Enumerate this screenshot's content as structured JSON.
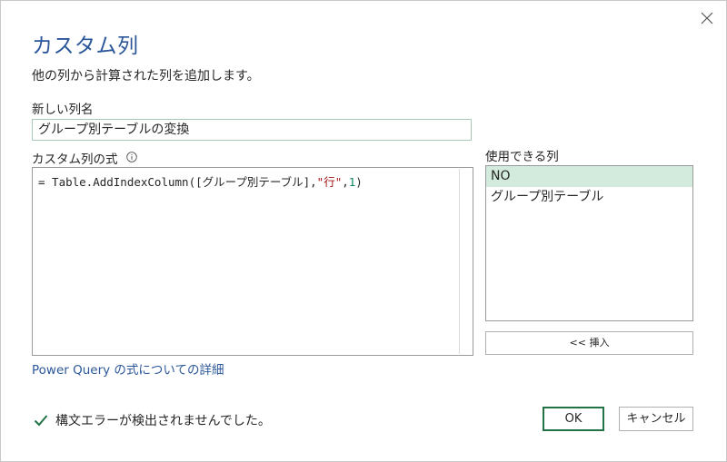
{
  "dialog": {
    "title": "カスタム列",
    "subtitle": "他の列から計算された列を追加します。",
    "close_icon": "close-icon"
  },
  "new_column": {
    "label": "新しい列名",
    "value": "グループ別テーブルの変換"
  },
  "formula": {
    "label": "カスタム列の式",
    "info_icon": "info-icon",
    "prefix": "= Table.AddIndexColumn([グループ別テーブル],",
    "string_arg": "\"行\"",
    "comma": ",",
    "number_arg": "1",
    "suffix": ")"
  },
  "available_columns": {
    "label": "使用できる列",
    "items": [
      "NO",
      "グループ別テーブル"
    ],
    "selected_index": 0,
    "insert_label": "<< 挿入"
  },
  "help_link": "Power Query の式についての詳細",
  "status": {
    "icon": "checkmark-icon",
    "text": "構文エラーが検出されませんでした。",
    "color": "#217346"
  },
  "buttons": {
    "ok": "OK",
    "cancel": "キャンセル"
  },
  "colors": {
    "title": "#2b579a",
    "selected_row": "#d3ebdc",
    "accent": "#217346"
  }
}
